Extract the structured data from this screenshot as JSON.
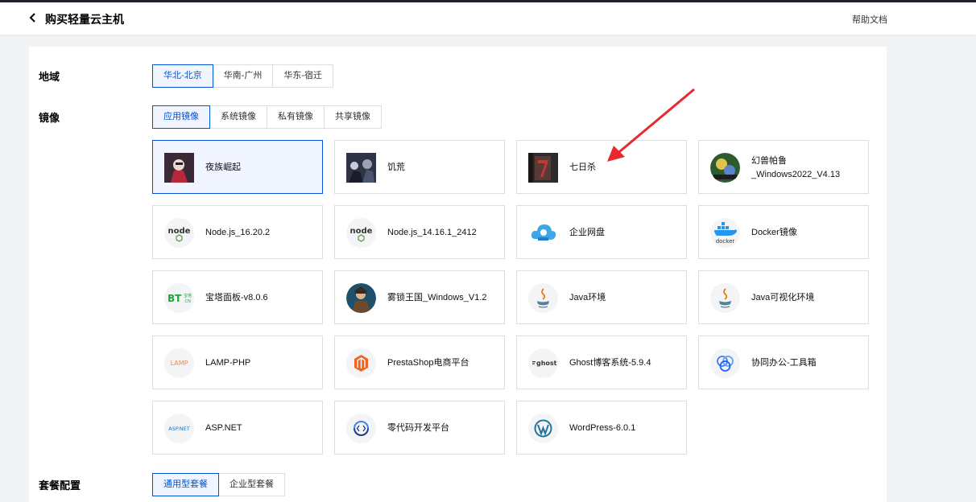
{
  "header": {
    "title": "购买轻量云主机",
    "help_label": "帮助文档"
  },
  "region": {
    "label": "地域",
    "options": [
      "华北-北京",
      "华南-广州",
      "华东-宿迁"
    ],
    "selected": "华北-北京"
  },
  "image": {
    "label": "镜像",
    "tabs": [
      "应用镜像",
      "系统镜像",
      "私有镜像",
      "共享镜像"
    ],
    "selected_tab": "应用镜像",
    "cards": [
      {
        "label": "夜族崛起",
        "icon": "vrising-game-icon"
      },
      {
        "label": "饥荒",
        "icon": "dont-starve-game-icon"
      },
      {
        "label": "七日杀",
        "icon": "7-days-to-die-game-icon"
      },
      {
        "label": "幻兽帕鲁_Windows2022_V4.13",
        "icon": "palworld-game-icon"
      },
      {
        "label": "Node.js_16.20.2",
        "icon": "nodejs-icon"
      },
      {
        "label": "Node.js_14.16.1_2412",
        "icon": "nodejs-icon"
      },
      {
        "label": "企业网盘",
        "icon": "cloud-disk-icon"
      },
      {
        "label": "Docker镜像",
        "icon": "docker-icon"
      },
      {
        "label": "宝塔面板-v8.0.6",
        "icon": "bt-panel-icon"
      },
      {
        "label": "雾锁王国_Windows_V1.2",
        "icon": "enshrouded-game-icon"
      },
      {
        "label": "Java环境",
        "icon": "java-icon"
      },
      {
        "label": "Java可视化环境",
        "icon": "java-icon"
      },
      {
        "label": "LAMP-PHP",
        "icon": "lamp-icon"
      },
      {
        "label": "PrestaShop电商平台",
        "icon": "prestashop-icon"
      },
      {
        "label": "Ghost博客系统-5.9.4",
        "icon": "ghost-icon"
      },
      {
        "label": "协同办公-工具箱",
        "icon": "collaboration-icon"
      },
      {
        "label": "ASP.NET",
        "icon": "aspnet-icon"
      },
      {
        "label": "零代码开发平台",
        "icon": "lowcode-icon"
      },
      {
        "label": "WordPress-6.0.1",
        "icon": "wordpress-icon"
      }
    ],
    "selected_card": "夜族崛起",
    "icon_text": {
      "node": "node",
      "bt": "BT",
      "bt_sub": "宝塔",
      "bt_cn": ".CN",
      "lamp": "LAMP",
      "ghost": "ghost",
      "aspnet": "ASP.NET",
      "docker": "docker"
    }
  },
  "plan": {
    "label": "套餐配置",
    "tabs": [
      "通用型套餐",
      "企业型套餐"
    ],
    "selected": "通用型套餐"
  },
  "colors": {
    "accent": "#0052d9",
    "accent_bg": "#f0f5ff",
    "annotation_arrow": "#e8292e"
  }
}
